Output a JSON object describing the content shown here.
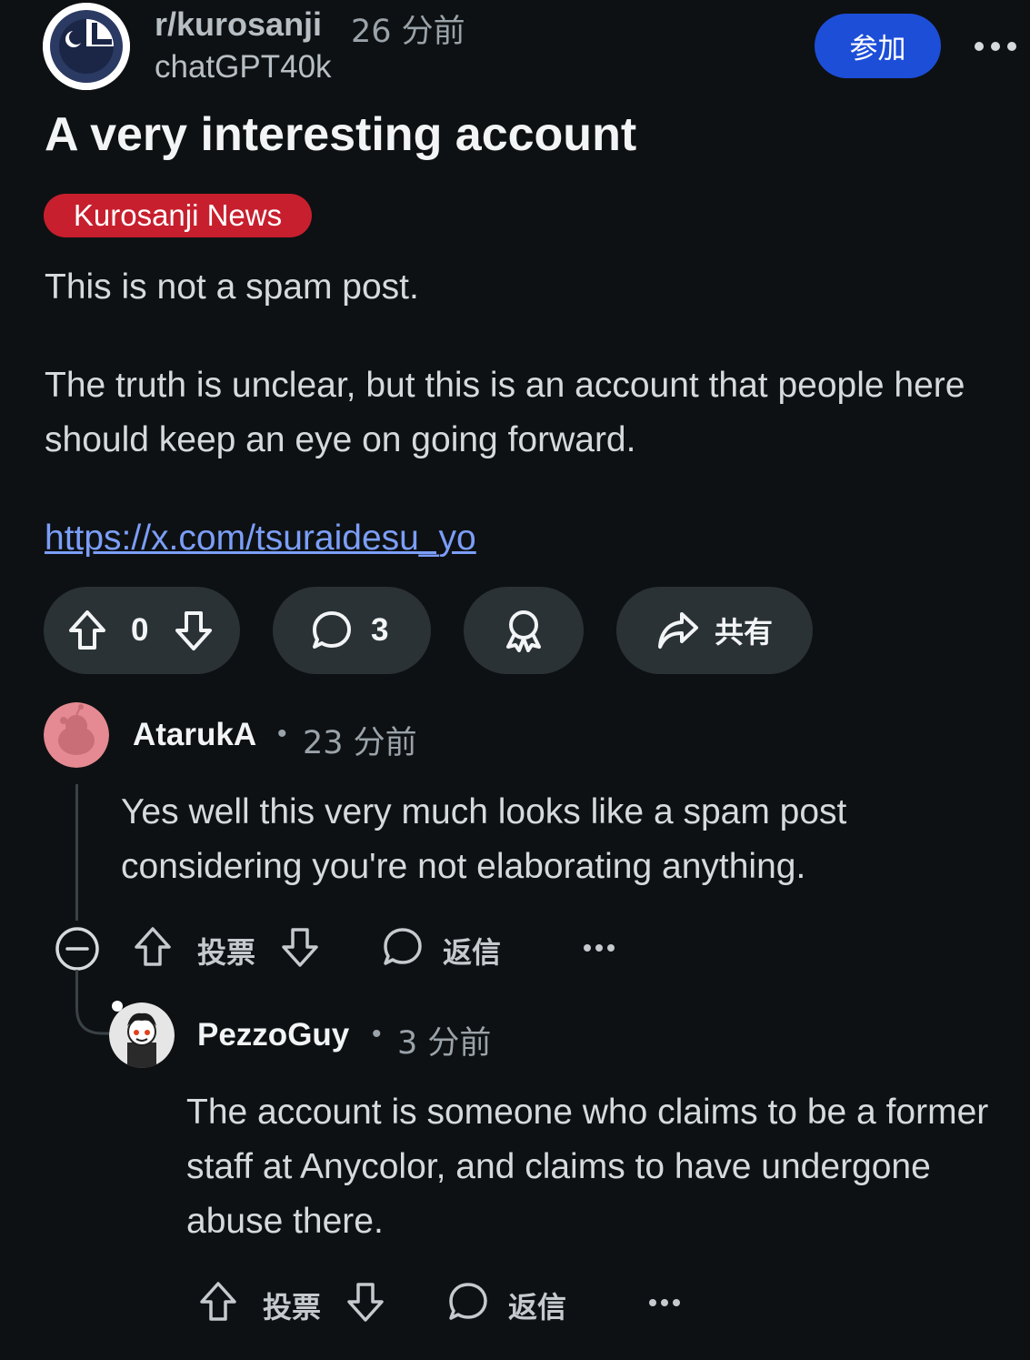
{
  "post": {
    "subreddit": "r/kurosanji",
    "time": "26 分前",
    "author": "chatGPT40k",
    "join_label": "参加",
    "title": "A very interesting account",
    "flair": "Kurosanji News",
    "body_p1": "This is not a spam post.",
    "body_p2": "The truth is unclear, but this is an account that people here should keep an eye on going forward.",
    "link": "https://x.com/tsuraidesu_yo",
    "votes": "0",
    "comments": "3",
    "share_label": "共有"
  },
  "comments": [
    {
      "user": "AtarukA",
      "time": "23 分前",
      "body": "Yes well this very much looks like a spam post considering you're not elaborating anything.",
      "vote_label": "投票",
      "reply_label": "返信"
    },
    {
      "user": "PezzoGuy",
      "time": "3 分前",
      "body": "The account is someone who claims to be a former staff at Anycolor, and claims to have undergone abuse there.",
      "vote_label": "投票",
      "reply_label": "返信"
    }
  ],
  "colors": {
    "background": "#0e1113",
    "join_button": "#1d4ed8",
    "flair": "#c71f2e",
    "link": "#7b9ef8",
    "pill": "#2a3236"
  },
  "icons": [
    "subreddit-avatar",
    "more-icon",
    "upvote-icon",
    "downvote-icon",
    "comment-icon",
    "award-icon",
    "share-icon",
    "collapse-icon",
    "reply-icon",
    "user-avatar"
  ]
}
